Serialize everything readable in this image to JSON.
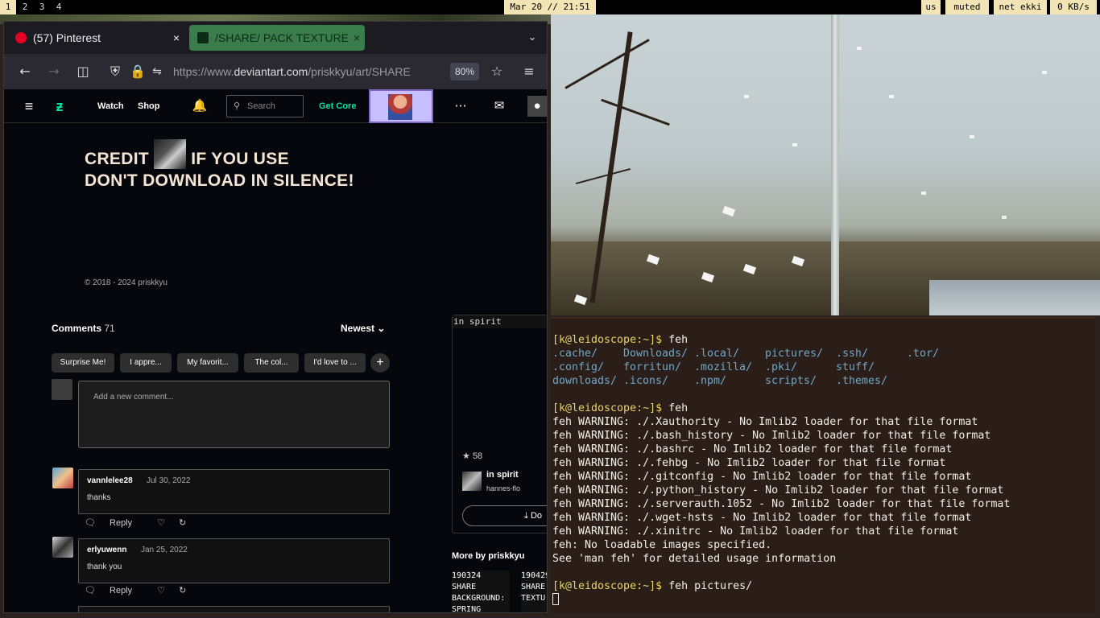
{
  "statusbar": {
    "workspaces": [
      "1",
      "2",
      "3",
      "4"
    ],
    "clock": "Mar 20 // 21:51",
    "layout": "us",
    "volume": "muted",
    "net": "net ekki",
    "speed": "0 KB/s"
  },
  "browser": {
    "tabs": [
      {
        "title": "(57) Pinterest",
        "close": "×"
      },
      {
        "title": "/SHARE/ PACK TEXTURE",
        "close": "×"
      }
    ],
    "tab_list_icon": "chevron-down-icon",
    "url_prefix": "https://www.",
    "url_domain": "deviantart.com",
    "url_path": "/priskkyu/art/SHARE",
    "zoom": "80%"
  },
  "site_header": {
    "watch": "Watch",
    "shop": "Shop",
    "search_placeholder": "Search",
    "get_core": "Get Core"
  },
  "artwork": {
    "line1_before": "CREDIT",
    "line1_after": "IF YOU USE",
    "line2": "DON'T DOWNLOAD IN SILENCE!",
    "copyright": "© 2018 - 2024 priskkyu"
  },
  "comments": {
    "label": "Comments",
    "count": "71",
    "sort": "Newest",
    "chips": [
      "Surprise Me!",
      "I appre...",
      "My favorit...",
      "The col...",
      "I'd love to ..."
    ],
    "add_chip": "+",
    "placeholder": "Add a new comment...",
    "items": [
      {
        "user": "vannlelee28",
        "date": "Jul 30, 2022",
        "text": "thanks"
      },
      {
        "user": "erlyuwenn",
        "date": "Jan 25, 2022",
        "text": "thank you"
      }
    ],
    "reply_label": "Reply"
  },
  "sidebar": {
    "header_text": "in spirit",
    "favourites": "58",
    "title": "in spirit",
    "user": "hannes-flo",
    "download_label": "Do",
    "more_by": "More by priskkyu",
    "thumbs": [
      "190324\nSHARE\nBACKGROUND:\nSPRING",
      "190429\nSHARE\nTEXTU"
    ]
  },
  "terminal": {
    "lines": [
      {
        "cls": "prompt",
        "text": "[k@leidoscope:~]$",
        "rest": " feh"
      },
      {
        "cls": "dirs",
        "cols": [
          ".cache/",
          "Downloads/",
          ".local/",
          "pictures/",
          ".ssh/",
          ".tor/"
        ]
      },
      {
        "cls": "dirs",
        "cols": [
          ".config/",
          "forritun/",
          ".mozilla/",
          ".pki/",
          "stuff/"
        ]
      },
      {
        "cls": "dirs",
        "cols": [
          "downloads/",
          ".icons/",
          ".npm/",
          "scripts/",
          ".themes/"
        ]
      },
      {
        "cls": "blank",
        "text": ""
      },
      {
        "cls": "prompt",
        "text": "[k@leidoscope:~]$",
        "rest": " feh"
      },
      {
        "cls": "text",
        "text": "feh WARNING: ./.Xauthority - No Imlib2 loader for that file format"
      },
      {
        "cls": "text",
        "text": "feh WARNING: ./.bash_history - No Imlib2 loader for that file format"
      },
      {
        "cls": "text",
        "text": "feh WARNING: ./.bashrc - No Imlib2 loader for that file format"
      },
      {
        "cls": "text",
        "text": "feh WARNING: ./.fehbg - No Imlib2 loader for that file format"
      },
      {
        "cls": "text",
        "text": "feh WARNING: ./.gitconfig - No Imlib2 loader for that file format"
      },
      {
        "cls": "text",
        "text": "feh WARNING: ./.python_history - No Imlib2 loader for that file format"
      },
      {
        "cls": "text",
        "text": "feh WARNING: ./.serverauth.1052 - No Imlib2 loader for that file format"
      },
      {
        "cls": "text",
        "text": "feh WARNING: ./.wget-hsts - No Imlib2 loader for that file format"
      },
      {
        "cls": "text",
        "text": "feh WARNING: ./.xinitrc - No Imlib2 loader for that file format"
      },
      {
        "cls": "text",
        "text": "feh: No loadable images specified."
      },
      {
        "cls": "text",
        "text": "See 'man feh' for detailed usage information"
      },
      {
        "cls": "blank",
        "text": ""
      },
      {
        "cls": "prompt",
        "text": "[k@leidoscope:~]$",
        "rest": " feh pictures/"
      }
    ]
  },
  "colors": {
    "accent_tab": "#3a7c4c",
    "status_bg": "#f2e4b4",
    "deviantart_green": "#00e59b",
    "prompt": "#e8d36a",
    "dir": "#6fa7c9",
    "terminal_bg": "#2b1e19"
  }
}
